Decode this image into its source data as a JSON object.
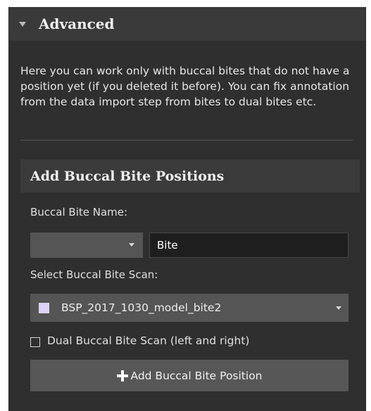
{
  "section": {
    "title": "Advanced",
    "expanded_icon": "triangle-down-icon",
    "description": "Here you can work only with buccal bites that do not have a position yet (if you deleted it before). You can fix annotation from the data import step from bites to dual bites etc."
  },
  "form": {
    "title": "Add Buccal Bite Positions",
    "name_label": "Buccal Bite Name:",
    "name_prefix_value": "",
    "name_value": "Bite",
    "scan_label": "Select Buccal Bite Scan:",
    "scan_selected": "BSP_2017_1030_model_bite2",
    "scan_color": "#dcd2f5",
    "dual_checkbox_label": "Dual Buccal Bite Scan (left and right)",
    "dual_checked": false,
    "add_button_label": "Add Buccal Bite Position",
    "add_button_icon": "plus-icon"
  },
  "colors": {
    "panel_bg": "#2f2f2f",
    "header_bg": "#3a3a3a",
    "control_bg": "#555555",
    "input_bg": "#1e1e1e"
  }
}
